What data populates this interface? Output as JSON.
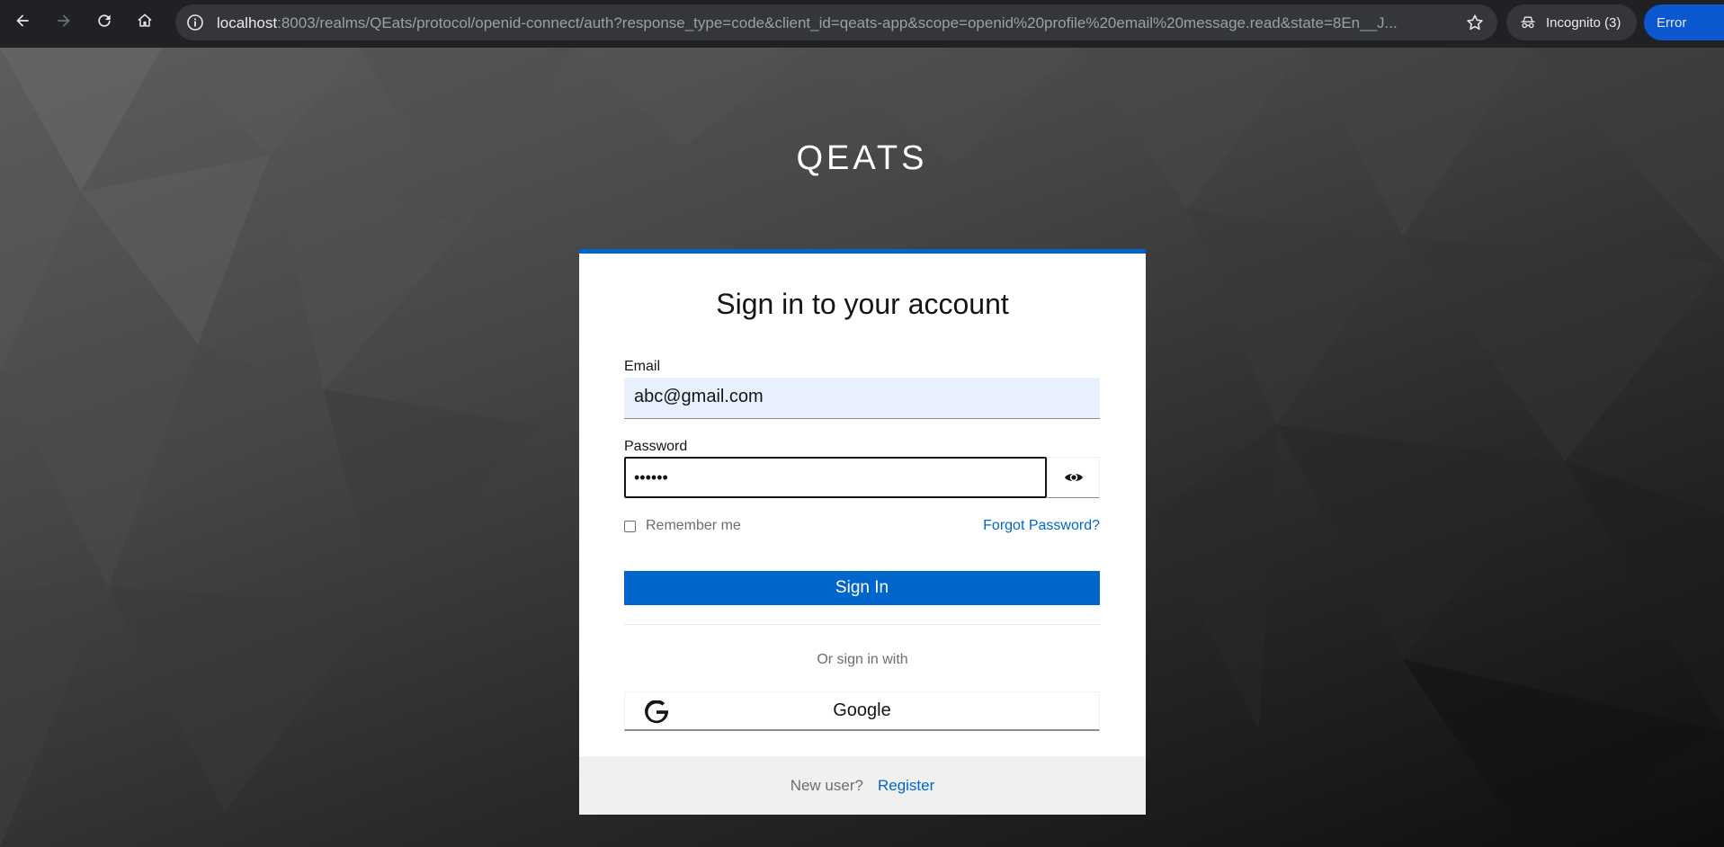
{
  "browser": {
    "url_host": "localhost",
    "url_rest": ":8003/realms/QEats/protocol/openid-connect/auth?response_type=code&client_id=qeats-app&scope=openid%20profile%20email%20message.read&state=8En__J...",
    "incognito_label": "Incognito (3)",
    "error_label": "Error",
    "icons": [
      "back-icon",
      "forward-icon",
      "reload-icon",
      "home-icon",
      "info-icon",
      "star-icon",
      "incognito-icon"
    ]
  },
  "brand": {
    "name": "QEATS"
  },
  "login": {
    "title": "Sign in to your account",
    "email_label": "Email",
    "email_value": "abc@gmail.com",
    "password_label": "Password",
    "password_value": "••••••",
    "remember_label": "Remember me",
    "forgot_label": "Forgot Password?",
    "signin_label": "Sign In",
    "or_label": "Or sign in with",
    "google_label": "Google",
    "new_user_label": "New user?",
    "register_label": "Register"
  },
  "colors": {
    "accent": "#0066cc",
    "chrome_bg": "#202124",
    "email_bg": "#e8f0fe",
    "footer_bg": "#f0f0f0"
  }
}
